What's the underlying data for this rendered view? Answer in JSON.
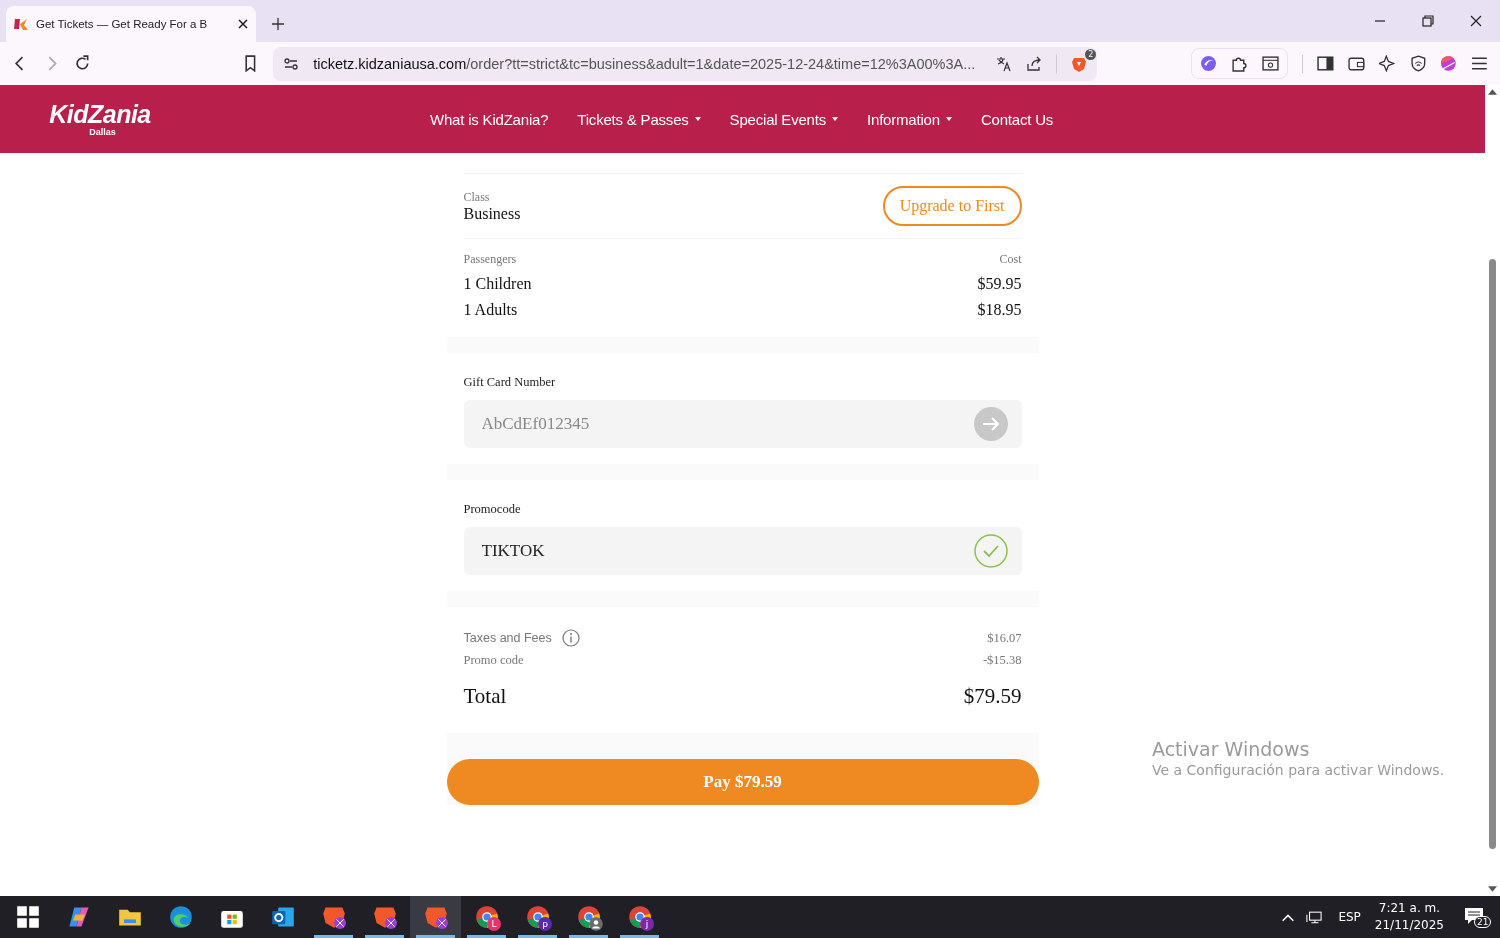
{
  "browser": {
    "tabs": [
      {
        "title": "Get Tickets — Get Ready For a B",
        "selected": true
      }
    ],
    "url_host": "ticketz.kidzaniausa.com",
    "url_path": "/order?tt=strict&tc=business&adult=1&date=2025-12-24&time=12%3A00%3A...",
    "shield_badge": "2"
  },
  "site": {
    "logo": "KidZania",
    "logo_sub": "Dallas",
    "nav": [
      {
        "label": "What is KidZania?",
        "dropdown": false
      },
      {
        "label": "Tickets & Passes",
        "dropdown": true
      },
      {
        "label": "Special Events",
        "dropdown": true
      },
      {
        "label": "Information",
        "dropdown": true
      },
      {
        "label": "Contact Us",
        "dropdown": false
      }
    ]
  },
  "order": {
    "class_label": "Class",
    "class_value": "Business",
    "upgrade_button": "Upgrade to First",
    "passengers_label": "Passengers",
    "cost_label": "Cost",
    "passengers": [
      {
        "name": "1 Children",
        "cost": "$59.95"
      },
      {
        "name": "1 Adults",
        "cost": "$18.95"
      }
    ]
  },
  "gift_card": {
    "label": "Gift Card Number",
    "placeholder": "AbCdEf012345"
  },
  "promo": {
    "label": "Promocode",
    "value": "TIKTOK",
    "valid": true
  },
  "summary": {
    "lines": [
      {
        "label": "Taxes and Fees",
        "value": "$16.07",
        "info": true
      },
      {
        "label": "Promo code",
        "value": "-$15.38",
        "info": false
      }
    ],
    "total_label": "Total",
    "total": "$79.59"
  },
  "pay_button": "Pay $79.59",
  "activation": {
    "title": "Activar Windows",
    "text": "Ve a Configuración para activar Windows."
  },
  "taskbar": {
    "apps": [
      {
        "kind": "start",
        "running": false,
        "selected": false
      },
      {
        "kind": "copilot",
        "running": false,
        "selected": false
      },
      {
        "kind": "folder",
        "running": false,
        "selected": false
      },
      {
        "kind": "edge",
        "running": false,
        "selected": false
      },
      {
        "kind": "store",
        "running": false,
        "selected": false
      },
      {
        "kind": "outlook",
        "running": false,
        "selected": false
      },
      {
        "kind": "brave",
        "running": true,
        "selected": false
      },
      {
        "kind": "brave",
        "running": true,
        "selected": false
      },
      {
        "kind": "brave",
        "running": true,
        "selected": true
      },
      {
        "kind": "chrome",
        "running": true,
        "selected": false,
        "badge": "L",
        "color": "#e8336b"
      },
      {
        "kind": "chrome",
        "running": true,
        "selected": false,
        "badge": "p",
        "color": "#5b2aa8"
      },
      {
        "kind": "chrome",
        "running": true,
        "selected": false,
        "profile_icon": true,
        "color": "#6b6b6b"
      },
      {
        "kind": "chrome",
        "running": true,
        "selected": false,
        "badge": "j",
        "color": "#7a2aa8"
      }
    ],
    "language": "ESP",
    "time": "7:21 a. m.",
    "date": "21/11/2025",
    "notifications": "21"
  }
}
